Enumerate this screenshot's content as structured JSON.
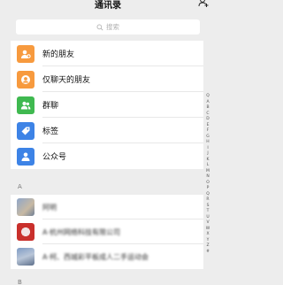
{
  "header": {
    "title": "通讯录"
  },
  "search": {
    "placeholder": "搜索"
  },
  "menu": [
    {
      "label": "新的朋友",
      "color": "#f79a3e",
      "icon": "add-friend-icon"
    },
    {
      "label": "仅聊天的朋友",
      "color": "#f79a3e",
      "icon": "chat-only-friend-icon"
    },
    {
      "label": "群聊",
      "color": "#3fb950",
      "icon": "group-chat-icon"
    },
    {
      "label": "标签",
      "color": "#3d83e6",
      "icon": "tag-icon"
    },
    {
      "label": "公众号",
      "color": "#3d83e6",
      "icon": "official-account-icon"
    }
  ],
  "sections": [
    {
      "letter": "A",
      "contacts": [
        {
          "name": "阿明"
        },
        {
          "name": "A·杭州网络科技有限公司"
        },
        {
          "name": "A·柯、西城彩平板成人二手运动会"
        }
      ]
    },
    {
      "letter": "B"
    }
  ],
  "index": [
    "Q",
    "A",
    "B",
    "C",
    "D",
    "E",
    "F",
    "G",
    "H",
    "I",
    "J",
    "K",
    "L",
    "M",
    "N",
    "O",
    "P",
    "Q",
    "R",
    "S",
    "T",
    "U",
    "V",
    "W",
    "X",
    "Y",
    "Z",
    "#"
  ]
}
